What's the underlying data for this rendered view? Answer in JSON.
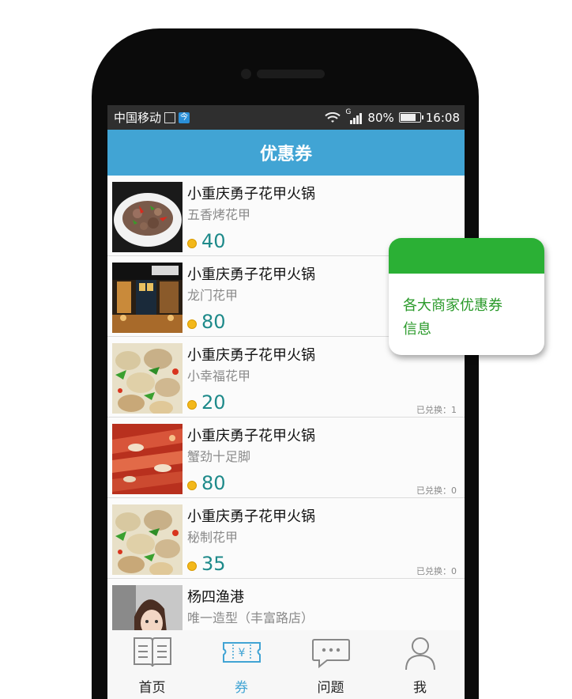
{
  "status_bar": {
    "carrier": "中国移动",
    "network": "G",
    "battery": "80%",
    "battery_level": 0.8,
    "time": "16:08"
  },
  "header": {
    "title": "优惠券"
  },
  "coupons": [
    {
      "shop": "小重庆勇子花甲火锅",
      "dish": "五香烤花甲",
      "price": "40",
      "redeemed": ""
    },
    {
      "shop": "小重庆勇子花甲火锅",
      "dish": "龙门花甲",
      "price": "80",
      "redeemed": ""
    },
    {
      "shop": "小重庆勇子花甲火锅",
      "dish": "小幸福花甲",
      "price": "20",
      "redeemed": "已兑换：1"
    },
    {
      "shop": "小重庆勇子花甲火锅",
      "dish": "蟹劲十足脚",
      "price": "80",
      "redeemed": "已兑换：0"
    },
    {
      "shop": "小重庆勇子花甲火锅",
      "dish": "秘制花甲",
      "price": "35",
      "redeemed": "已兑换：0"
    },
    {
      "shop": "杨四渔港",
      "dish": " 唯一造型（丰富路店）",
      "price": "",
      "redeemed": ""
    }
  ],
  "bottom_nav": [
    {
      "label": "首页",
      "icon": "book-icon",
      "active": false
    },
    {
      "label": "券",
      "icon": "coupon-icon",
      "active": true
    },
    {
      "label": "问题",
      "icon": "chat-icon",
      "active": false
    },
    {
      "label": "我",
      "icon": "user-icon",
      "active": false
    }
  ],
  "callout": {
    "text_line1": "各大商家优惠券",
    "text_line2": "信息"
  },
  "colors": {
    "accent": "#41a4d4",
    "price": "#1e8a8a",
    "callout_green": "#2bb035",
    "status_bar": "#2f2f2f"
  }
}
